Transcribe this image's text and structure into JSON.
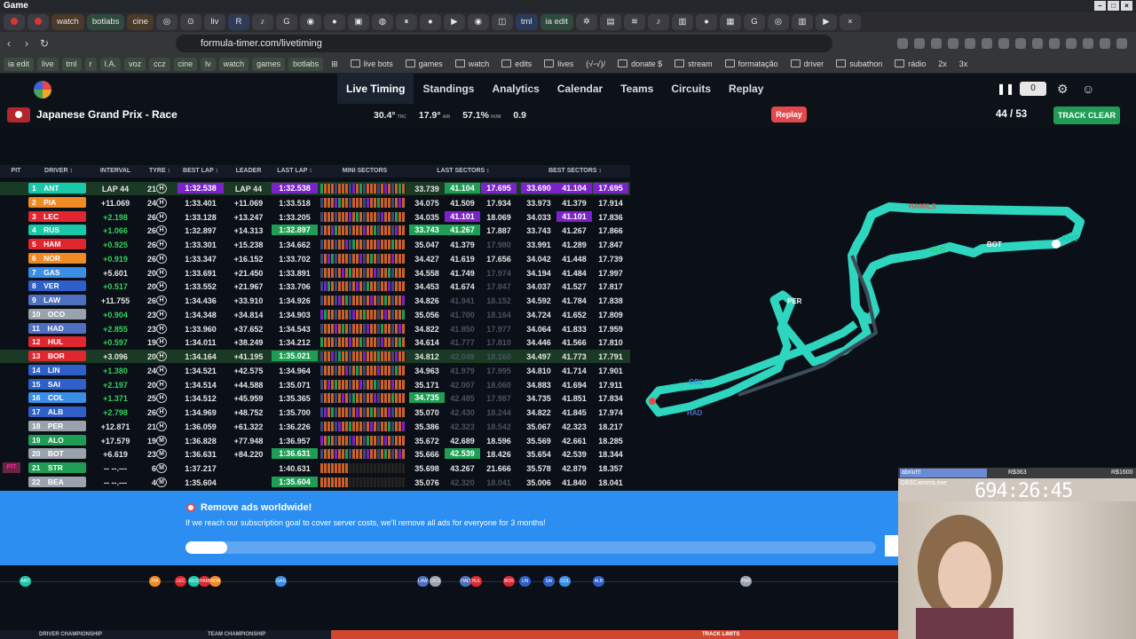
{
  "window": {
    "title": "Game"
  },
  "tabs": [
    "watch",
    "botlabs",
    "cine",
    "ia edit"
  ],
  "tab_misc": [
    "liv",
    "tml"
  ],
  "url": "formula-timer.com/livetiming",
  "bookmarks": [
    "ia edit",
    "live",
    "tml",
    "r",
    "I.A.",
    "voz",
    "ccz",
    "cine",
    "lv",
    "watch",
    "games",
    "botlabs",
    "live bots",
    "games",
    "watch",
    "edits",
    "lives",
    "(√ᵕ√)/",
    "donate $",
    "stream",
    "formatação",
    "driver",
    "subathon",
    "rádio",
    "2x",
    "3x"
  ],
  "nav": {
    "items": [
      "Live Timing",
      "Standings",
      "Analytics",
      "Calendar",
      "Teams",
      "Circuits",
      "Replay"
    ],
    "counter": "0"
  },
  "event": {
    "title": "Japanese Grand Prix - Race",
    "track_temp": "30.4°",
    "air_temp": "17.9°",
    "humidity": "57.1%",
    "wind": "0.9",
    "replay": "Replay",
    "lap": "44 / 53",
    "status": "TRACK CLEAR",
    "temp_labels": [
      "TRC",
      "AIR",
      "HUM"
    ]
  },
  "table": {
    "headers": [
      "PIT",
      "DRIVER ↕",
      "INTERVAL",
      "TYRE ↕",
      "BEST LAP ↕",
      "LEADER",
      "LAST LAP ↕",
      "MINI SECTORS",
      "LAST SECTORS ↕",
      "BEST SECTORS ↕"
    ],
    "rows": [
      {
        "pos": "1",
        "code": "ANT",
        "team": "#18c8a8",
        "interval": "LAP 44",
        "tyre": "21",
        "compound": "H",
        "best": "1:32.538",
        "leader": "LAP 44",
        "last": "1:32.538",
        "ls": [
          "33.739",
          "41.104",
          "17.695"
        ],
        "bs": [
          "33.690",
          "41.104",
          "17.695"
        ]
      },
      {
        "pos": "2",
        "code": "PIA",
        "team": "#f08a24",
        "interval": "+11.069",
        "tyre": "24",
        "compound": "H",
        "best": "1:33.401",
        "leader": "+11.069",
        "last": "1:33.518",
        "ls": [
          "34.075",
          "41.509",
          "17.934"
        ],
        "bs": [
          "33.973",
          "41.379",
          "17.914"
        ]
      },
      {
        "pos": "3",
        "code": "LEC",
        "team": "#e0262f",
        "interval": "+2.198",
        "tyre": "26",
        "compound": "H",
        "best": "1:33.128",
        "leader": "+13.247",
        "last": "1:33.205",
        "ls": [
          "34.035",
          "41.101",
          "18.069"
        ],
        "bs": [
          "34.033",
          "41.101",
          "17.836"
        ]
      },
      {
        "pos": "4",
        "code": "RUS",
        "team": "#18c8a8",
        "interval": "+1.066",
        "tyre": "26",
        "compound": "H",
        "best": "1:32.897",
        "leader": "+14.313",
        "last": "1:32.897",
        "ls": [
          "33.743",
          "41.267",
          "17.887"
        ],
        "bs": [
          "33.743",
          "41.267",
          "17.866"
        ]
      },
      {
        "pos": "5",
        "code": "HAM",
        "team": "#e0262f",
        "interval": "+0.925",
        "tyre": "26",
        "compound": "H",
        "best": "1:33.301",
        "leader": "+15.238",
        "last": "1:34.662",
        "ls": [
          "35.047",
          "41.379",
          "17.980"
        ],
        "bs": [
          "33.991",
          "41.289",
          "17.847"
        ]
      },
      {
        "pos": "6",
        "code": "NOR",
        "team": "#f08a24",
        "interval": "+0.919",
        "tyre": "26",
        "compound": "H",
        "best": "1:33.347",
        "leader": "+16.152",
        "last": "1:33.702",
        "ls": [
          "34.427",
          "41.619",
          "17.656"
        ],
        "bs": [
          "34.042",
          "41.448",
          "17.739"
        ]
      },
      {
        "pos": "7",
        "code": "GAS",
        "team": "#3a8ee6",
        "interval": "+5.601",
        "tyre": "20",
        "compound": "H",
        "best": "1:33.691",
        "leader": "+21.450",
        "last": "1:33.891",
        "ls": [
          "34.558",
          "41.749",
          "17.974"
        ],
        "bs": [
          "34.194",
          "41.484",
          "17.997"
        ]
      },
      {
        "pos": "8",
        "code": "VER",
        "team": "#2f5fc8",
        "interval": "+0.517",
        "tyre": "20",
        "compound": "H",
        "best": "1:33.552",
        "leader": "+21.967",
        "last": "1:33.706",
        "ls": [
          "34.453",
          "41.674",
          "17.847"
        ],
        "bs": [
          "34.037",
          "41.527",
          "17.817"
        ]
      },
      {
        "pos": "9",
        "code": "LAW",
        "team": "#4f6fc0",
        "interval": "+11.755",
        "tyre": "26",
        "compound": "H",
        "best": "1:34.436",
        "leader": "+33.910",
        "last": "1:34.926",
        "ls": [
          "34.826",
          "41.941",
          "18.152"
        ],
        "bs": [
          "34.592",
          "41.784",
          "17.838"
        ]
      },
      {
        "pos": "10",
        "code": "OCO",
        "team": "#9aa3ad",
        "interval": "+0.904",
        "tyre": "23",
        "compound": "H",
        "best": "1:34.348",
        "leader": "+34.814",
        "last": "1:34.903",
        "ls": [
          "35.056",
          "41.700",
          "18.164"
        ],
        "bs": [
          "34.724",
          "41.652",
          "17.809"
        ]
      },
      {
        "pos": "11",
        "code": "HAD",
        "team": "#4f6fc0",
        "interval": "+2.855",
        "tyre": "23",
        "compound": "H",
        "best": "1:33.960",
        "leader": "+37.652",
        "last": "1:34.543",
        "ls": [
          "34.822",
          "41.850",
          "17.977"
        ],
        "bs": [
          "34.064",
          "41.833",
          "17.959"
        ]
      },
      {
        "pos": "12",
        "code": "HUL",
        "team": "#e0262f",
        "interval": "+0.597",
        "tyre": "19",
        "compound": "H",
        "best": "1:34.011",
        "leader": "+38.249",
        "last": "1:34.212",
        "ls": [
          "34.614",
          "41.777",
          "17.810"
        ],
        "bs": [
          "34.446",
          "41.566",
          "17.810"
        ]
      },
      {
        "pos": "13",
        "code": "BOR",
        "team": "#e0262f",
        "interval": "+3.096",
        "tyre": "20",
        "compound": "H",
        "best": "1:34.164",
        "leader": "+41.195",
        "last": "1:35.021",
        "ls": [
          "34.812",
          "42.049",
          "18.160"
        ],
        "bs": [
          "34.497",
          "41.773",
          "17.791"
        ]
      },
      {
        "pos": "14",
        "code": "LIN",
        "team": "#2f5fc8",
        "interval": "+1.380",
        "tyre": "24",
        "compound": "H",
        "best": "1:34.521",
        "leader": "+42.575",
        "last": "1:34.964",
        "ls": [
          "34.963",
          "41.979",
          "17.995"
        ],
        "bs": [
          "34.810",
          "41.714",
          "17.901"
        ]
      },
      {
        "pos": "15",
        "code": "SAI",
        "team": "#2f5fc8",
        "interval": "+2.197",
        "tyre": "20",
        "compound": "H",
        "best": "1:34.514",
        "leader": "+44.588",
        "last": "1:35.071",
        "ls": [
          "35.171",
          "42.007",
          "18.060"
        ],
        "bs": [
          "34.883",
          "41.694",
          "17.911"
        ]
      },
      {
        "pos": "16",
        "code": "COL",
        "team": "#3a8ee6",
        "interval": "+1.371",
        "tyre": "25",
        "compound": "H",
        "best": "1:34.512",
        "leader": "+45.959",
        "last": "1:35.365",
        "ls": [
          "34.735",
          "42.485",
          "17.987"
        ],
        "bs": [
          "34.735",
          "41.851",
          "17.834"
        ]
      },
      {
        "pos": "17",
        "code": "ALB",
        "team": "#2f5fc8",
        "interval": "+2.798",
        "tyre": "26",
        "compound": "H",
        "best": "1:34.969",
        "leader": "+48.752",
        "last": "1:35.700",
        "ls": [
          "35.070",
          "42.430",
          "18.244"
        ],
        "bs": [
          "34.822",
          "41.845",
          "17.974"
        ]
      },
      {
        "pos": "18",
        "code": "PER",
        "team": "#9aa3ad",
        "interval": "+12.871",
        "tyre": "21",
        "compound": "H",
        "best": "1:36.059",
        "leader": "+61.322",
        "last": "1:36.226",
        "ls": [
          "35.386",
          "42.323",
          "18.542"
        ],
        "bs": [
          "35.067",
          "42.323",
          "18.217"
        ]
      },
      {
        "pos": "19",
        "code": "ALO",
        "team": "#1f9d55",
        "interval": "+17.579",
        "tyre": "19",
        "compound": "M",
        "best": "1:36.828",
        "leader": "+77.948",
        "last": "1:36.957",
        "ls": [
          "35.672",
          "42.689",
          "18.596"
        ],
        "bs": [
          "35.569",
          "42.661",
          "18.285"
        ]
      },
      {
        "pos": "20",
        "code": "BOT",
        "team": "#9aa3ad",
        "interval": "+6.619",
        "tyre": "23",
        "compound": "M",
        "best": "1:36.631",
        "leader": "+84.220",
        "last": "1:36.631",
        "ls": [
          "35.666",
          "42.539",
          "18.426"
        ],
        "bs": [
          "35.654",
          "42.539",
          "18.344"
        ]
      },
      {
        "pos": "21",
        "code": "STR",
        "team": "#1f9d55",
        "interval": "-- --.---",
        "tyre": "6",
        "compound": "M",
        "best": "1:37.217",
        "leader": "",
        "last": "1:40.631",
        "ls": [
          "35.698",
          "43.267",
          "21.666"
        ],
        "bs": [
          "35.578",
          "42.879",
          "18.357"
        ],
        "pit": "PIT"
      },
      {
        "pos": "22",
        "code": "BEA",
        "team": "#9aa3ad",
        "interval": "-- --.---",
        "tyre": "4",
        "compound": "M",
        "best": "1:35.604",
        "leader": "",
        "last": "1:35.604",
        "ls": [
          "35.076",
          "42.320",
          "18.041"
        ],
        "bs": [
          "35.006",
          "41.840",
          "18.041"
        ]
      }
    ]
  },
  "map_labels": [
    "HAMILS",
    "ALO",
    "BOT",
    "ANT",
    "PER",
    "COL",
    "HAD"
  ],
  "ad": {
    "title": "Remove ads worldwide!",
    "text": "If we reach our subscription goal to cover server costs, we'll remove all ads for everyone for 3 months!",
    "progress": 0.06
  },
  "strip": [
    "ANT",
    "PIA",
    "LEC",
    "RUS",
    "HAM",
    "NOR",
    "GAS",
    "LAW",
    "OCO",
    "HAD",
    "HUL",
    "BOR",
    "LIN",
    "SAI",
    "COL",
    "ALB",
    "PER"
  ],
  "footer": [
    "DRIVER CHAMPIONSHIP",
    "TEAM CHAMPIONSHIP",
    "TRACK LIMITS"
  ],
  "cam": {
    "label": "abriu!!!",
    "amt1": "R$363",
    "amt2": "R$1600",
    "source": "OBSCamera.exe",
    "timer": "694:26:45"
  }
}
